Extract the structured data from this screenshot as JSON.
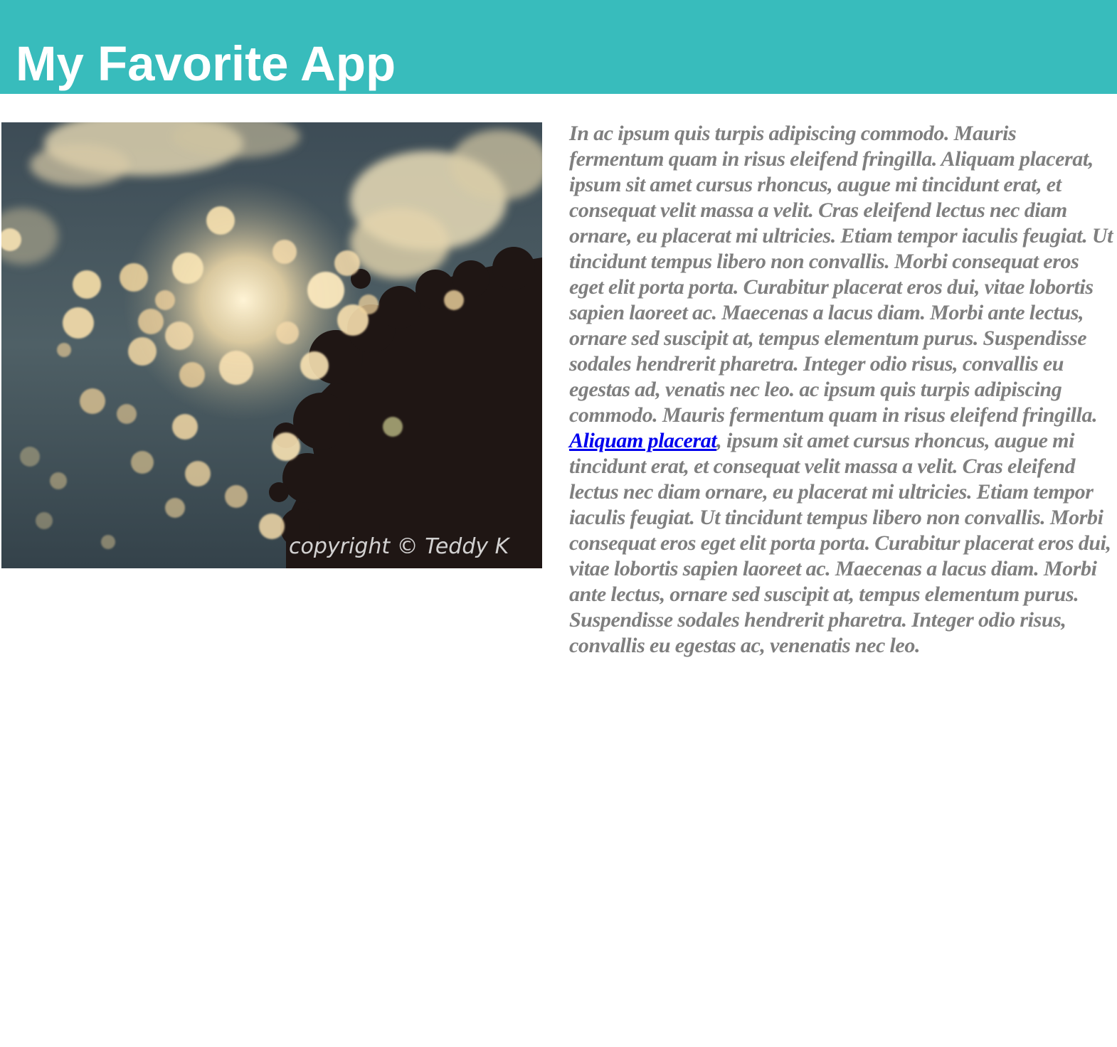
{
  "header": {
    "title": "My Favorite App",
    "background_color": "#38bcbc",
    "title_color": "#ffffff"
  },
  "photo": {
    "alt": "bokeh-sunlight-through-trees-photo",
    "watermark": "copyright © Teddy K"
  },
  "article": {
    "text_color": "#7f7f7f",
    "link_color": "#0000ee",
    "text_before_link": "In ac ipsum quis turpis adipiscing commodo. Mauris fermentum quam in risus eleifend fringilla. Aliquam placerat, ipsum sit amet cursus rhoncus, augue mi tincidunt erat, et consequat velit massa a velit. Cras eleifend lectus nec diam ornare, eu placerat mi ultricies. Etiam tempor iaculis feugiat. Ut tincidunt tempus libero non convallis. Morbi consequat eros eget elit porta porta. Curabitur placerat eros dui, vitae lobortis sapien laoreet ac. Maecenas a lacus diam. Morbi ante lectus, ornare sed suscipit at, tempus elementum purus. Suspendisse sodales hendrerit pharetra. Integer odio risus, convallis eu egestas ad, venatis nec leo. ac ipsum quis turpis adipiscing commodo. Mauris fermentum quam in risus eleifend fringilla. ",
    "link_text": "Aliquam placerat",
    "text_after_link": ", ipsum sit amet cursus rhoncus, augue mi tincidunt erat, et consequat velit massa a velit. Cras eleifend lectus nec diam ornare, eu placerat mi ultricies. Etiam tempor iaculis feugiat. Ut tincidunt tempus libero non convallis. Morbi consequat eros eget elit porta porta. Curabitur placerat eros dui, vitae lobortis sapien laoreet ac. Maecenas a lacus diam. Morbi ante lectus, ornare sed suscipit at, tempus elementum purus. Suspendisse sodales hendrerit pharetra. Integer odio risus, convallis eu egestas ac, venenatis nec leo."
  }
}
